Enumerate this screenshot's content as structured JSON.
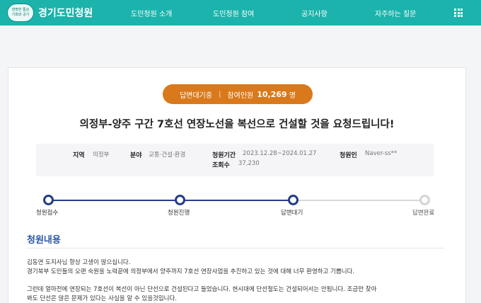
{
  "header": {
    "logo_badge_line1": "현명한 통상",
    "logo_badge_line2": "기회와 공기",
    "site_title": "경기도민청원",
    "nav": [
      "도민청원 소개",
      "도민청원 참여",
      "공지사항",
      "자주하는 질문"
    ],
    "menu_icon": "grid-menu-icon"
  },
  "petition": {
    "status": "답변대기중",
    "participants_label": "참여인원",
    "participants_count": "10,269",
    "participants_unit": "명",
    "title": "의정부-양주 구간 7호선 연장노선을 복선으로 건설할 것을 요청드립니다!",
    "info": {
      "region_label": "지역",
      "region_value": "의정부",
      "field_label": "분야",
      "field_value": "교통·건설·환경",
      "period_label": "청원기간",
      "period_value": "2023.12.28~2024.01.27",
      "views_label": "조회수",
      "views_value": "37,230",
      "petitioner_label": "청원인",
      "petitioner_value": "Naver-ss**"
    },
    "steps": [
      {
        "label": "청원접수",
        "active": true
      },
      {
        "label": "청원진행",
        "active": true
      },
      {
        "label": "답변대기",
        "active": true
      },
      {
        "label": "답변완료",
        "active": false
      }
    ],
    "content_title": "청원내용",
    "content_lines": [
      "김동연 도지사님 항상 고생이 많으십니다.",
      "경기북부 도민들의 오랜 숙원을 노력끝에 의정부에서 양주까지 7호선 연장사업을 추진하고 있는 것에 대해 너무 환영하고 기쁩니다.",
      "",
      "그런데 얼마전에 연장되는 7호선이 복선이 아닌 단선으로 건설된다고 들었습니다. 현시대에 단선철도는 건설되어서는 안됩니다. 조금만 찾아",
      "봐도 단선은 많은 문제가 있다는 사실을 알 수 있을것입니다."
    ]
  },
  "colors": {
    "brand": "#1bb3ab",
    "status_pill": "#d9791b",
    "step_active": "#223c86",
    "section_title": "#2a57a8"
  }
}
